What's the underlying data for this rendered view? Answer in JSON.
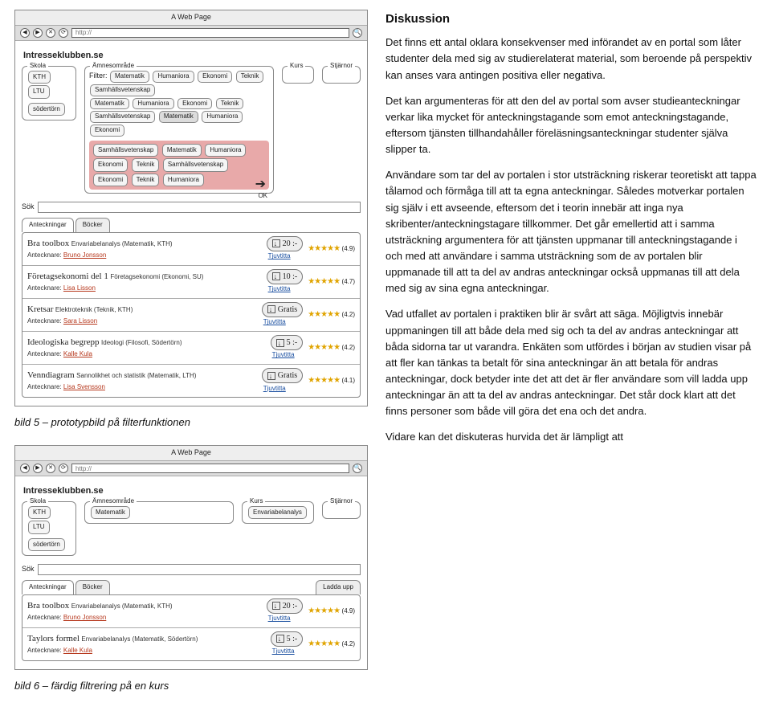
{
  "heading": "Diskussion",
  "paragraphs": [
    "Det finns ett antal oklara konsekvenser med införandet av en portal som låter studenter dela med sig av studierelaterat material, som beroende på perspektiv kan anses vara antingen positiva eller negativa.",
    "Det kan argumenteras för att den del av portal som avser studieanteckningar verkar lika mycket för anteckningstagande som emot anteckningstagande, eftersom tjänsten tillhandahåller föreläsningsanteckningar studenter själva slipper ta.",
    "Användare som tar del av portalen i stor utsträckning riskerar teoretiskt att tappa tålamod och förmåga till att ta egna anteckningar. Således motverkar portalen sig själv i ett avseende, eftersom det i teorin innebär att inga nya skribenter/anteckningstagare tillkommer. Det går emellertid att i samma utsträckning argumentera för att tjänsten uppmanar till anteckningstagande i och med att användare i samma utsträckning som de av portalen blir uppmanade till att ta del av andras anteckningar också uppmanas till att dela med sig av sina egna anteckningar.",
    "Vad utfallet av portalen i praktiken blir är svårt att säga. Möjligtvis innebär uppmaningen till att både dela med sig och ta del av andras anteckningar att båda sidorna tar ut varandra. Enkäten som utfördes i början av studien visar på att fler kan tänkas ta betalt för sina anteckningar än att betala för andras anteckningar, dock betyder inte det att det är fler användare som vill ladda upp anteckningar än att ta del av andras anteckningar. Det står dock klart att det finns personer som både vill göra det ena och det andra.",
    "Vidare kan det diskuteras hurvida det är lämpligt att"
  ],
  "caption1": "bild 5 – prototypbild på filterfunktionen",
  "caption2": "bild 6 – färdig filtrering på en kurs",
  "mockup": {
    "windowTitle": "A Web Page",
    "urlPlaceholder": "http://",
    "site": "Intresseklubben.se",
    "sections": {
      "skola": "Skola",
      "amnesomrade": "Ämnesområde",
      "kurs": "Kurs",
      "stjarnor": "Stjärnor",
      "filter": "Filter:"
    },
    "schools": [
      "KTH",
      "LTU",
      "södertörn"
    ],
    "subject": "Matematik",
    "kurs2": "Envariabelanalys",
    "filterTags": [
      "Matematik",
      "Humaniora",
      "Ekonomi",
      "Teknik",
      "Samhällsvetenskap"
    ],
    "tagRows": [
      [
        "Matematik",
        "Humaniora",
        "Ekonomi",
        "Teknik",
        "Samhällsvetenskap",
        "Matematik",
        "Humaniora",
        "Ekonomi"
      ],
      [
        "Samhällsvetenskap",
        "Matematik",
        "Humaniora",
        "Ekonomi",
        "Teknik",
        "Samhällsvetenskap"
      ],
      [
        "Ekonomi",
        "Teknik",
        "Humaniora"
      ]
    ],
    "ok": "OK",
    "searchLabel": "Sök",
    "tabs": {
      "anteckningar": "Anteckningar",
      "bocker": "Böcker",
      "laddaUpp": "Ladda upp"
    },
    "anteckLabel": "Antecknare:",
    "tjuvtitta": "Tjuvtitta",
    "items1": [
      {
        "title": "Bra toolbox",
        "sub": "Envariabelanalys (Matematik, KTH)",
        "author": "Bruno Jonsson",
        "price": "20 :-",
        "rating": "(4.9)"
      },
      {
        "title": "Företagsekonomi del 1",
        "sub": "Företagsekonomi (Ekonomi, SU)",
        "author": "Lisa Lisson",
        "price": "10 :-",
        "rating": "(4.7)"
      },
      {
        "title": "Kretsar",
        "sub": "Elektroteknik (Teknik, KTH)",
        "author": "Sara Lisson",
        "price": "Gratis",
        "rating": "(4.2)"
      },
      {
        "title": "Ideologiska begrepp",
        "sub": "Ideologi (Filosofi, Södertörn)",
        "author": "Kalle Kula",
        "price": "5 :-",
        "rating": "(4.2)"
      },
      {
        "title": "Venndiagram",
        "sub": "Sannolikhet och statistik (Matematik, LTH)",
        "author": "Lisa Svensson",
        "price": "Gratis",
        "rating": "(4.1)"
      }
    ],
    "items2": [
      {
        "title": "Bra toolbox",
        "sub": "Envariabelanalys (Matematik, KTH)",
        "author": "Bruno Jonsson",
        "price": "20 :-",
        "rating": "(4.9)"
      },
      {
        "title": "Taylors formel",
        "sub": "Envariabelanalys (Matematik, Södertörn)",
        "author": "Kalle Kula",
        "price": "5 :-",
        "rating": "(4.2)"
      }
    ]
  }
}
